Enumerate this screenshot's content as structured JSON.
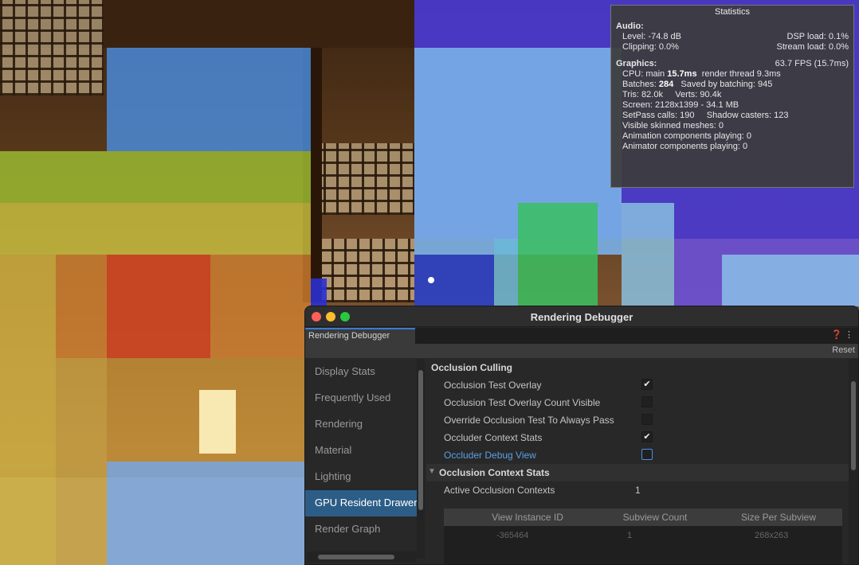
{
  "statistics": {
    "title": "Statistics",
    "audio_header": "Audio:",
    "level": "Level: -74.8 dB",
    "dsp_load": "DSP load: 0.1%",
    "clipping": "Clipping: 0.0%",
    "stream_load": "Stream load: 0.0%",
    "graphics_header": "Graphics:",
    "fps": "63.7 FPS (15.7ms)",
    "cpu_prefix": "CPU: main ",
    "cpu_main": "15.7ms",
    "cpu_render": "render thread 9.3ms",
    "batches_prefix": "Batches: ",
    "batches": "284",
    "saved_by_batching": "Saved by batching: 945",
    "tris": "Tris: 82.0k",
    "verts": "Verts: 90.4k",
    "screen": "Screen: 2128x1399 - 34.1 MB",
    "setpass": "SetPass calls: 190",
    "shadow_casters": "Shadow casters: 123",
    "visible_skinned": "Visible skinned meshes: 0",
    "animation_components": "Animation components playing: 0",
    "animator_components": "Animator components playing: 0"
  },
  "debugger": {
    "window_title": "Rendering Debugger",
    "tab_label": "Rendering Debugger",
    "help_icon": "help-icon",
    "menu_icon": "kebab-menu-icon",
    "reset_label": "Reset",
    "traffic_lights": {
      "close": "#ff5f57",
      "minimize": "#febc2e",
      "zoom": "#28c840"
    },
    "sidebar": [
      {
        "label": "Display Stats",
        "active": false
      },
      {
        "label": "Frequently Used",
        "active": false
      },
      {
        "label": "Rendering",
        "active": false
      },
      {
        "label": "Material",
        "active": false
      },
      {
        "label": "Lighting",
        "active": false
      },
      {
        "label": "GPU Resident Drawer",
        "active": true
      },
      {
        "label": "Render Graph",
        "active": false
      }
    ],
    "section_title": "Occlusion Culling",
    "rows": [
      {
        "label": "Occlusion Test Overlay",
        "checked": "✔"
      },
      {
        "label": "Occlusion Test Overlay Count Visible",
        "checked": ""
      },
      {
        "label": "Override Occlusion Test To Always Pass",
        "checked": ""
      },
      {
        "label": "Occluder Context Stats",
        "checked": "✔"
      },
      {
        "label": "Occluder Debug View",
        "checked": ""
      }
    ],
    "stats_group": "Occlusion Context Stats",
    "active_contexts_label": "Active Occlusion Contexts",
    "active_contexts_value": "1",
    "table_headers": [
      "View Instance ID",
      "Subview Count",
      "Size Per Subview"
    ],
    "table_row": [
      "-365464",
      "1",
      "268x263"
    ],
    "accent_color": "#2c5d87",
    "highlight_text_color": "#5aa0e6"
  }
}
